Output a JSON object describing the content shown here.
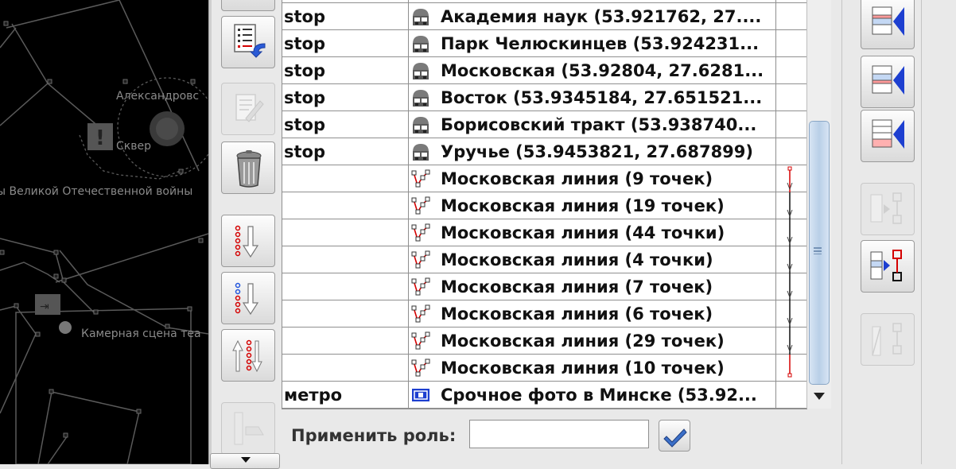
{
  "map": {
    "labels": {
      "alexandrovsky": "Александровс",
      "skver": "Сквер",
      "vov": "ы Великой Отечественной войны",
      "kamernaya": "Камерная сцена теа"
    }
  },
  "table": {
    "rows": [
      {
        "key": "stop",
        "icon": "bus-stop-icon",
        "name": "Академия наук (53.921762, 27...."
      },
      {
        "key": "stop",
        "icon": "bus-stop-icon",
        "name": "Парк Челюскинцев (53.924231..."
      },
      {
        "key": "stop",
        "icon": "bus-stop-icon",
        "name": "Московская (53.92804, 27.6281..."
      },
      {
        "key": "stop",
        "icon": "bus-stop-icon",
        "name": "Восток (53.9345184, 27.651521..."
      },
      {
        "key": "stop",
        "icon": "bus-stop-icon",
        "name": "Борисовский тракт (53.938740..."
      },
      {
        "key": "stop",
        "icon": "bus-stop-icon",
        "name": "Уручье (53.9453821, 27.687899)"
      },
      {
        "key": "",
        "icon": "way-icon",
        "name": "Московская линия (9 точек)"
      },
      {
        "key": "",
        "icon": "way-icon",
        "name": "Московская линия (19 точек)"
      },
      {
        "key": "",
        "icon": "way-icon",
        "name": "Московская линия (44 точки)"
      },
      {
        "key": "",
        "icon": "way-icon",
        "name": "Московская линия (4 точки)"
      },
      {
        "key": "",
        "icon": "way-icon",
        "name": "Московская линия (7 точек)"
      },
      {
        "key": "",
        "icon": "way-icon",
        "name": "Московская линия (6 точек)"
      },
      {
        "key": "",
        "icon": "way-icon",
        "name": "Московская линия (29 точек)"
      },
      {
        "key": "",
        "icon": "way-icon",
        "name": "Московская линия (10 точек)"
      },
      {
        "key": "метро",
        "icon": "photo-icon",
        "name": "Срочное фото в Минске (53.92..."
      }
    ]
  },
  "role": {
    "label": "Применить роль:",
    "value": "",
    "placeholder": ""
  },
  "toolbar_left": {
    "icons": [
      "properties-icon",
      "edit-icon",
      "delete-icon",
      "sort-down-red-icon",
      "sort-down-blue-icon",
      "reverse-icon",
      "more-icon"
    ]
  },
  "toolbar_right": {
    "icons": [
      "add-before-icon",
      "add-after-icon",
      "add-end-icon",
      "select-members-icon",
      "add-selected-icon",
      "remove-icon"
    ]
  },
  "colors": {
    "accent_blue": "#1d3fd0",
    "red": "#d40000",
    "thumb": "#b9cfe7"
  }
}
